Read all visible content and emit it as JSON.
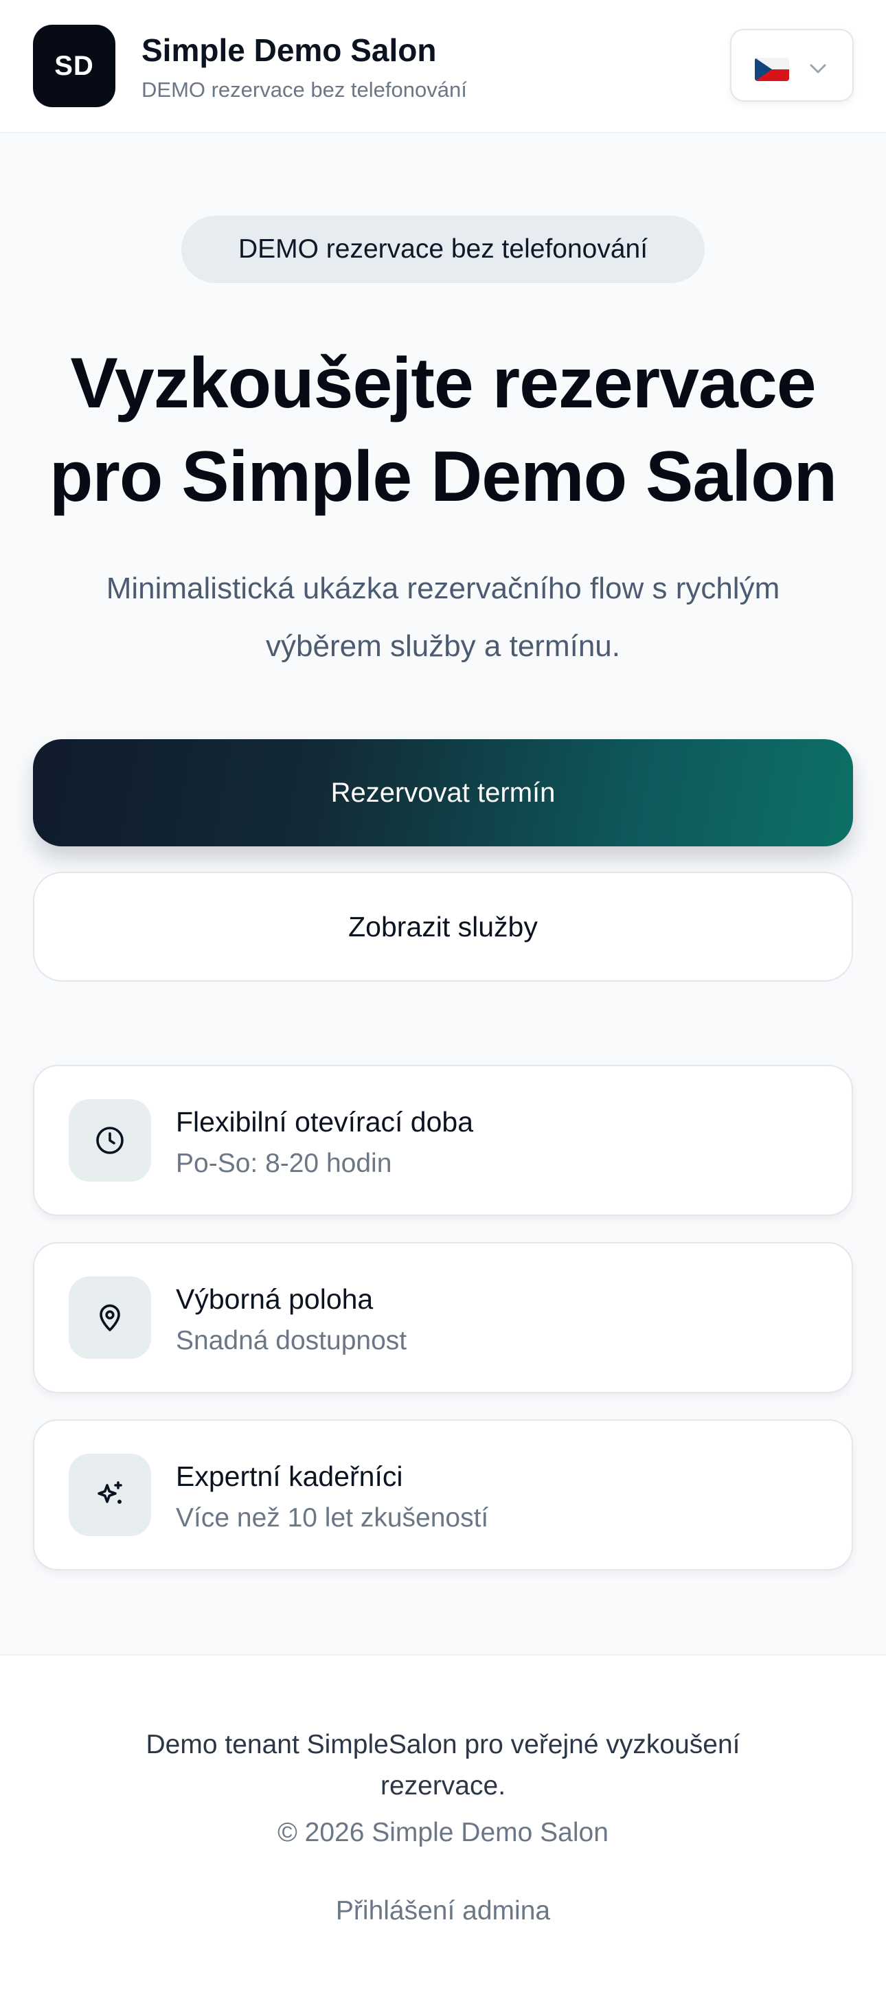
{
  "header": {
    "logo_text": "SD",
    "brand_name": "Simple Demo Salon",
    "tagline": "DEMO rezervace bez telefonování",
    "language_flag": "czech-flag-icon"
  },
  "hero": {
    "pill_text": "DEMO rezervace bez telefonování",
    "title_line1": "Vyzkoušejte rezervace",
    "title_line2": "pro Simple Demo Salon",
    "subtitle_line1": "Minimalistická ukázka rezervačního flow s rychlým",
    "subtitle_line2": "výběrem služby a termínu."
  },
  "actions": {
    "primary_label": "Rezervovat termín",
    "secondary_label": "Zobrazit služby"
  },
  "features": [
    {
      "icon": "clock-icon",
      "title": "Flexibilní otevírací doba",
      "subtitle": "Po-So: 8-20 hodin"
    },
    {
      "icon": "map-pin-icon",
      "title": "Výborná poloha",
      "subtitle": "Snadná dostupnost"
    },
    {
      "icon": "sparkles-icon",
      "title": "Expertní kadeřníci",
      "subtitle": "Více než 10 let zkušeností"
    }
  ],
  "footer": {
    "note_line1": "Demo tenant SimpleSalon pro veřejné vyzkoušení",
    "note_line2": "rezervace.",
    "copyright": "© 2026 Simple Demo Salon",
    "admin_link": "Přihlášení admina"
  },
  "colors": {
    "logo_bg": "#070b16",
    "primary_gradient_start": "#101b2c",
    "primary_gradient_end": "#0d7065",
    "pill_bg": "#e6ecef",
    "muted_text": "#6b7686"
  }
}
